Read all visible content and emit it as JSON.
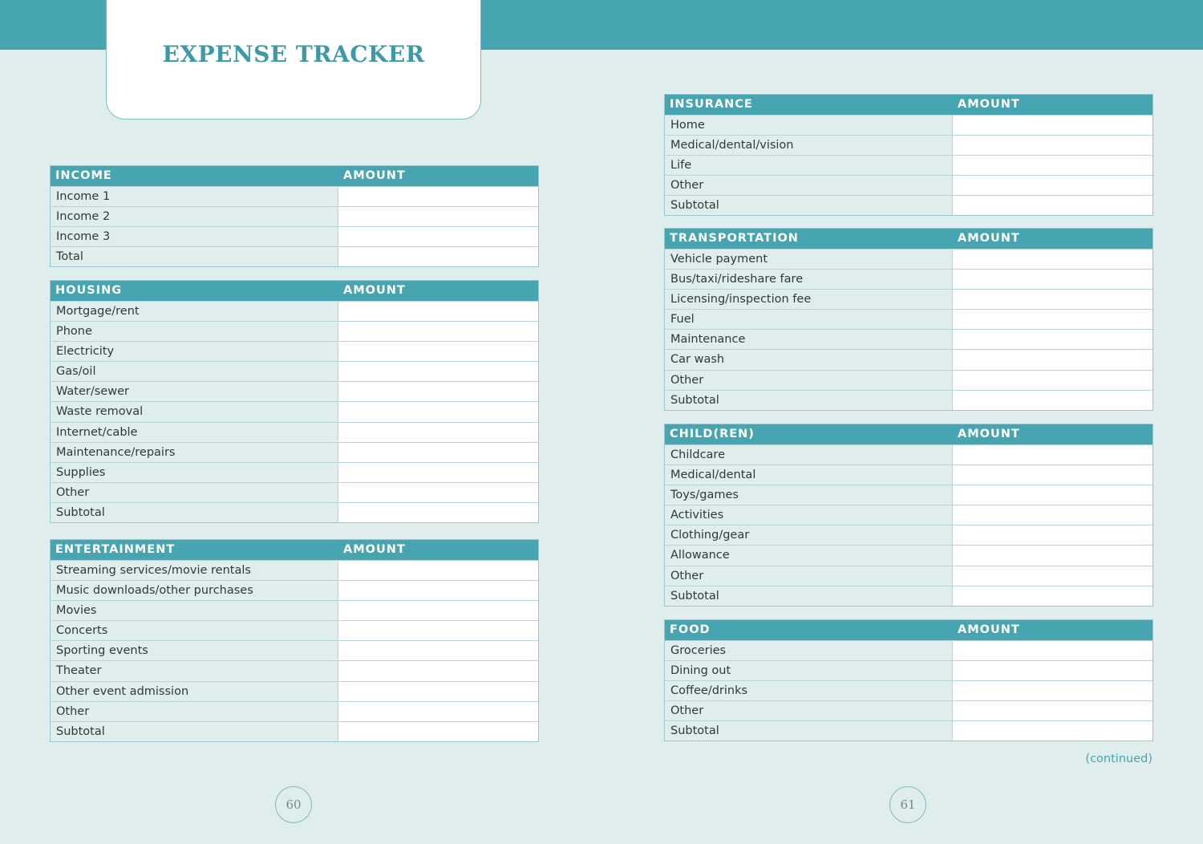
{
  "title": "EXPENSE TRACKER",
  "continued": "(continued)",
  "pages": {
    "left": "60",
    "right": "61"
  },
  "colors": {
    "accent": "#46a5b0",
    "background": "#e0eded",
    "cell": "#ffffff"
  },
  "sections": {
    "income": {
      "header": "INCOME",
      "amount": "AMOUNT",
      "rows": [
        "Income 1",
        "Income 2",
        "Income 3",
        "Total"
      ]
    },
    "housing": {
      "header": "HOUSING",
      "amount": "AMOUNT",
      "rows": [
        "Mortgage/rent",
        "Phone",
        "Electricity",
        "Gas/oil",
        "Water/sewer",
        "Waste removal",
        "Internet/cable",
        "Maintenance/repairs",
        "Supplies",
        "Other",
        "Subtotal"
      ]
    },
    "entertainment": {
      "header": "ENTERTAINMENT",
      "amount": "AMOUNT",
      "rows": [
        "Streaming services/movie rentals",
        "Music downloads/other purchases",
        "Movies",
        "Concerts",
        "Sporting events",
        "Theater",
        "Other event admission",
        "Other",
        "Subtotal"
      ]
    },
    "insurance": {
      "header": "INSURANCE",
      "amount": "AMOUNT",
      "rows": [
        "Home",
        "Medical/dental/vision",
        "Life",
        "Other",
        "Subtotal"
      ]
    },
    "transportation": {
      "header": "TRANSPORTATION",
      "amount": "AMOUNT",
      "rows": [
        "Vehicle payment",
        "Bus/taxi/rideshare fare",
        "Licensing/inspection fee",
        "Fuel",
        "Maintenance",
        "Car wash",
        "Other",
        "Subtotal"
      ]
    },
    "children": {
      "header": "CHILD(REN)",
      "amount": "AMOUNT",
      "rows": [
        "Childcare",
        "Medical/dental",
        "Toys/games",
        "Activities",
        "Clothing/gear",
        "Allowance",
        "Other",
        "Subtotal"
      ]
    },
    "food": {
      "header": "FOOD",
      "amount": "AMOUNT",
      "rows": [
        "Groceries",
        "Dining out",
        "Coffee/drinks",
        "Other",
        "Subtotal"
      ]
    }
  }
}
